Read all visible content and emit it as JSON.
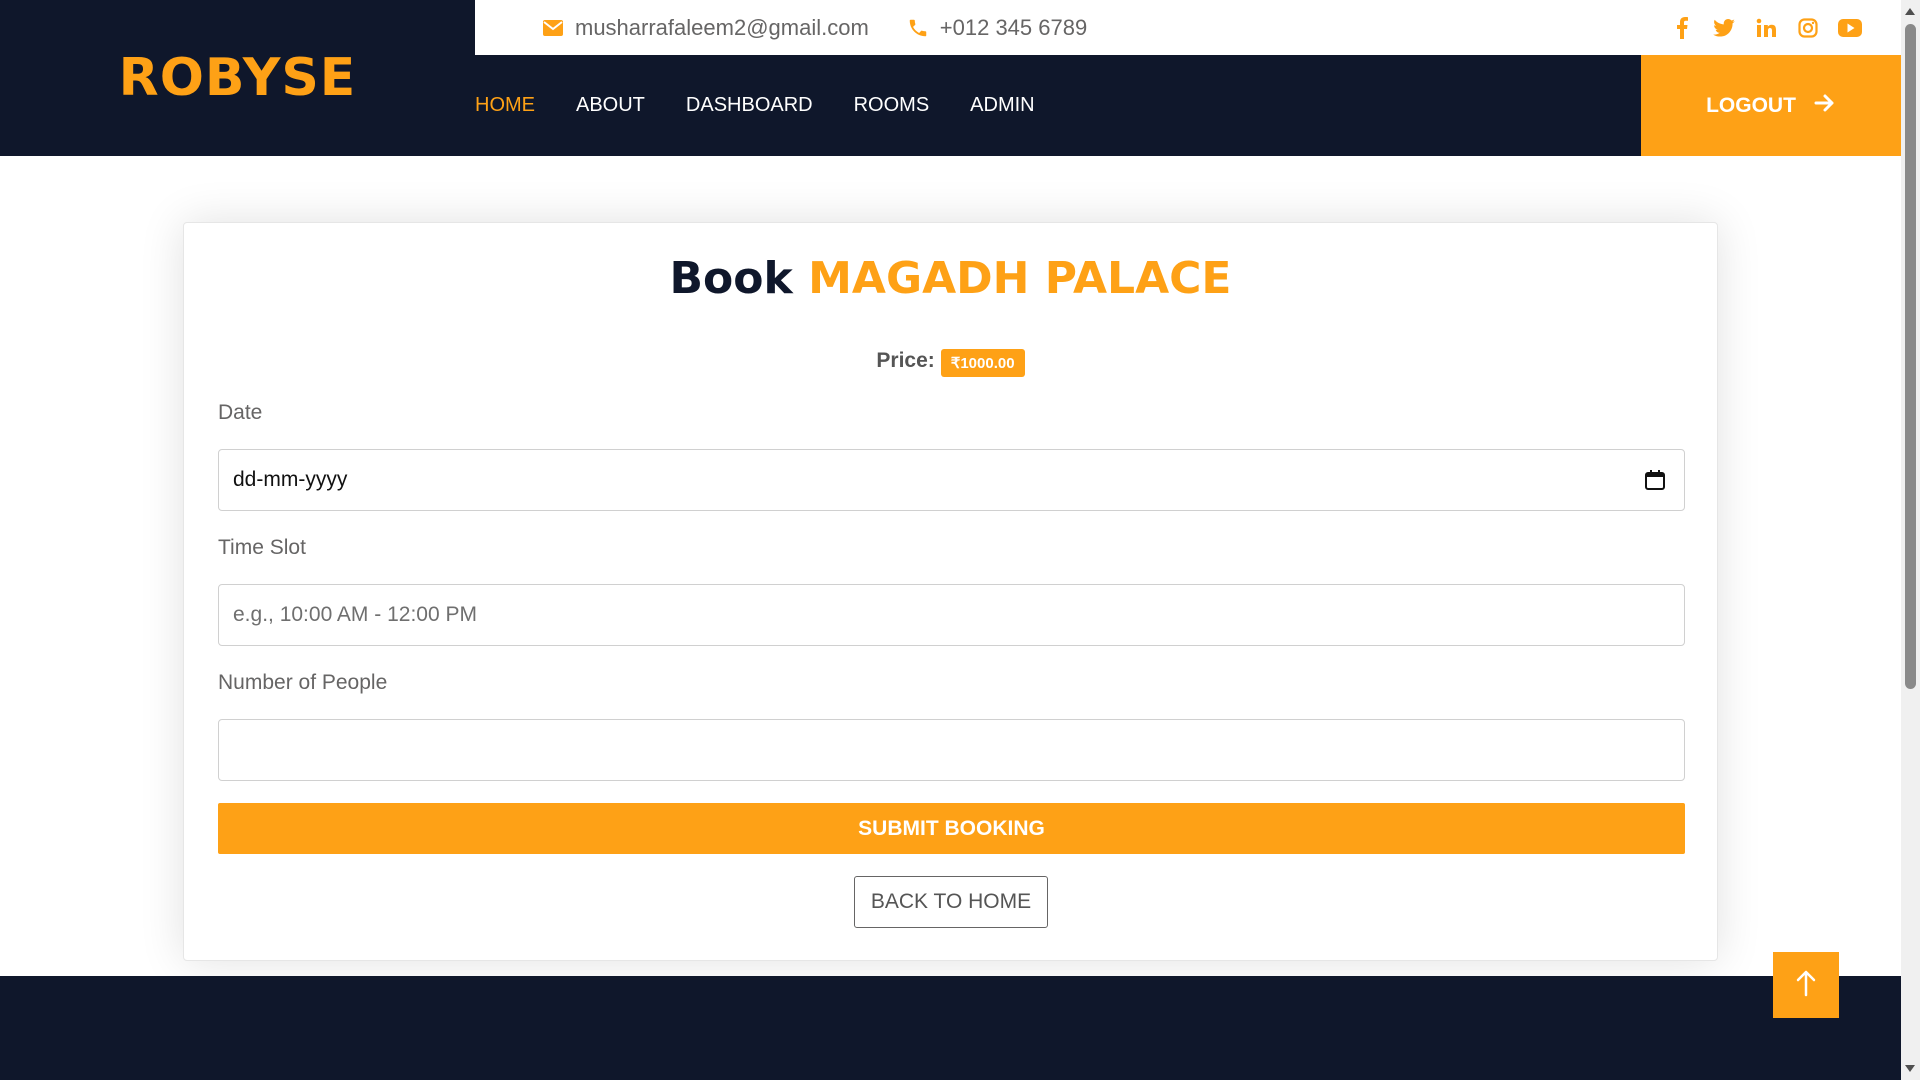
{
  "brand": {
    "name": "ROBYSE"
  },
  "topbar": {
    "email": "musharrafaleem2@gmail.com",
    "phone": "+012 345 6789",
    "social_icons": [
      "facebook-icon",
      "twitter-icon",
      "linkedin-icon",
      "instagram-icon",
      "youtube-icon"
    ]
  },
  "nav": {
    "items": [
      {
        "label": "HOME",
        "active": true
      },
      {
        "label": "ABOUT",
        "active": false
      },
      {
        "label": "DASHBOARD",
        "active": false
      },
      {
        "label": "ROOMS",
        "active": false
      },
      {
        "label": "ADMIN",
        "active": false
      }
    ],
    "logout_label": "LOGOUT"
  },
  "booking": {
    "title_prefix": "Book",
    "room_name": "MAGADH PALACE",
    "price_label": "Price:",
    "price_value": "₹1000.00",
    "date_label": "Date",
    "date_value": "dd-mm-yyyy",
    "time_label": "Time Slot",
    "time_placeholder": "e.g., 10:00 AM - 12:00 PM",
    "people_label": "Number of People",
    "people_value": "",
    "submit_label": "SUBMIT BOOKING",
    "back_label": "BACK TO HOME"
  },
  "colors": {
    "accent": "#fea116",
    "dark": "#0f172b",
    "text_muted": "#666565"
  }
}
